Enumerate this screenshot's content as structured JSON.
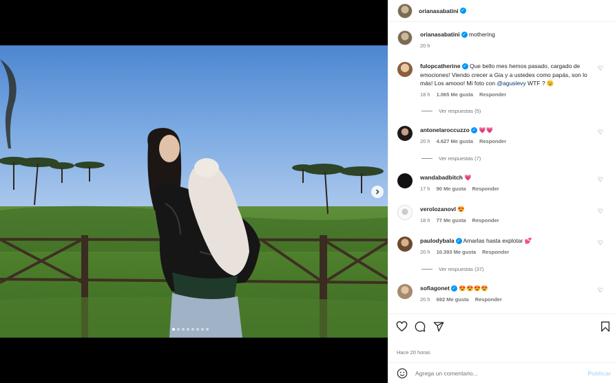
{
  "post": {
    "author": "orianasabatini",
    "caption_author": "orianasabatini",
    "caption_text": "mothering",
    "caption_time": "20 h",
    "time_ago": "Hace 20 horas"
  },
  "comments": [
    {
      "user": "fulopcatherine",
      "text_before": "Que bello mes hemos pasado, cargado de emociones! Viendo crecer a Gia y a ustedes como papás, son lo más! Los amooo! Mi foto con ",
      "mention": "@aguslevy",
      "text_after": " WTF ? 😉",
      "time": "18 h",
      "likes": "1.065 Me gusta",
      "reply": "Responder",
      "view_replies": "Ver respuestas (5)"
    },
    {
      "user": "antonelaroccuzzo",
      "text": "💗💗",
      "time": "20 h",
      "likes": "4.627 Me gusta",
      "reply": "Responder",
      "view_replies": "Ver respuestas (7)"
    },
    {
      "user": "wandabadbitch",
      "text": "💗",
      "time": "17 h",
      "likes": "90 Me gusta",
      "reply": "Responder"
    },
    {
      "user": "verolozanovl",
      "text": "😍",
      "time": "18 h",
      "likes": "77 Me gusta",
      "reply": "Responder"
    },
    {
      "user": "paulodybala",
      "text": "Amarlas hasta explotar 💕",
      "time": "20 h",
      "likes": "10.393 Me gusta",
      "reply": "Responder",
      "view_replies": "Ver respuestas (37)"
    },
    {
      "user": "sofiagonet",
      "text": "😍😍😍😍",
      "time": "20 h",
      "likes": "692 Me gusta",
      "reply": "Responder"
    }
  ],
  "composer": {
    "placeholder": "Agrega un comentario...",
    "publish": "Publicar"
  },
  "carousel": {
    "slide_count": 8,
    "active_index": 0
  },
  "icons": {
    "like": "heart-icon",
    "comment": "comment-icon",
    "share": "share-icon",
    "save": "bookmark-icon",
    "emoji": "emoji-icon",
    "next": "chevron-right-icon"
  },
  "colors": {
    "verified": "#0095f6",
    "publish_disabled": "#b3dbff"
  }
}
